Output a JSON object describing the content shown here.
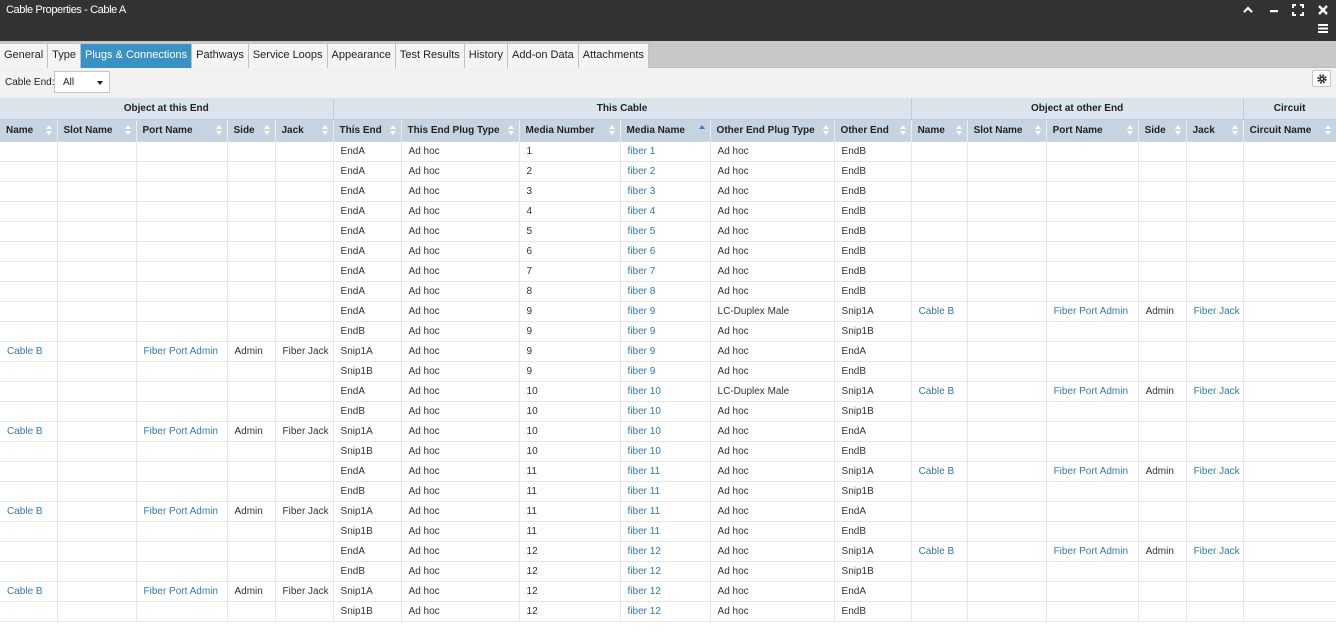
{
  "window": {
    "title": "Cable Properties - Cable A",
    "controls": [
      "chevron-up-icon",
      "minimize-icon",
      "maximize-icon",
      "close-icon",
      "menu-icon"
    ]
  },
  "tabs": [
    "General",
    "Type",
    "Plugs & Connections",
    "Pathways",
    "Service Loops",
    "Appearance",
    "Test Results",
    "History",
    "Add-on Data",
    "Attachments"
  ],
  "active_tab": "Plugs & Connections",
  "toolbar": {
    "cable_end_label": "Cable End:",
    "cable_end_value": "All",
    "settings_icon": "gear-icon"
  },
  "colors": {
    "titlebar": "#333333",
    "active_tab": "#3a92c4",
    "link": "#3478ad",
    "header": "#c6d4e2"
  },
  "grid": {
    "groups": [
      {
        "label": "Object at this End",
        "span": 5
      },
      {
        "label": "This Cable",
        "span": 6
      },
      {
        "label": "Object at other End",
        "span": 5
      },
      {
        "label": "Circuit",
        "span": 1
      }
    ],
    "columns": [
      "Name",
      "Slot Name",
      "Port Name",
      "Side",
      "Jack",
      "This End",
      "This End Plug Type",
      "Media Number",
      "Media Name",
      "Other End Plug Type",
      "Other End",
      "Name",
      "Slot Name",
      "Port Name",
      "Side",
      "Jack",
      "Circuit Name"
    ],
    "sorted_column": "Media Name",
    "rows": [
      [
        "",
        "",
        "",
        "",
        "",
        "EndA",
        "Ad hoc",
        "1",
        "fiber 1",
        "Ad hoc",
        "EndB",
        "",
        "",
        "",
        "",
        "",
        ""
      ],
      [
        "",
        "",
        "",
        "",
        "",
        "EndA",
        "Ad hoc",
        "2",
        "fiber 2",
        "Ad hoc",
        "EndB",
        "",
        "",
        "",
        "",
        "",
        ""
      ],
      [
        "",
        "",
        "",
        "",
        "",
        "EndA",
        "Ad hoc",
        "3",
        "fiber 3",
        "Ad hoc",
        "EndB",
        "",
        "",
        "",
        "",
        "",
        ""
      ],
      [
        "",
        "",
        "",
        "",
        "",
        "EndA",
        "Ad hoc",
        "4",
        "fiber 4",
        "Ad hoc",
        "EndB",
        "",
        "",
        "",
        "",
        "",
        ""
      ],
      [
        "",
        "",
        "",
        "",
        "",
        "EndA",
        "Ad hoc",
        "5",
        "fiber 5",
        "Ad hoc",
        "EndB",
        "",
        "",
        "",
        "",
        "",
        ""
      ],
      [
        "",
        "",
        "",
        "",
        "",
        "EndA",
        "Ad hoc",
        "6",
        "fiber 6",
        "Ad hoc",
        "EndB",
        "",
        "",
        "",
        "",
        "",
        ""
      ],
      [
        "",
        "",
        "",
        "",
        "",
        "EndA",
        "Ad hoc",
        "7",
        "fiber 7",
        "Ad hoc",
        "EndB",
        "",
        "",
        "",
        "",
        "",
        ""
      ],
      [
        "",
        "",
        "",
        "",
        "",
        "EndA",
        "Ad hoc",
        "8",
        "fiber 8",
        "Ad hoc",
        "EndB",
        "",
        "",
        "",
        "",
        "",
        ""
      ],
      [
        "",
        "",
        "",
        "",
        "",
        "EndA",
        "Ad hoc",
        "9",
        "fiber 9",
        "LC-Duplex Male",
        "Snip1A",
        "Cable B",
        "",
        "Fiber Port Admin",
        "Admin",
        "Fiber Jack",
        ""
      ],
      [
        "",
        "",
        "",
        "",
        "",
        "EndB",
        "Ad hoc",
        "9",
        "fiber 9",
        "Ad hoc",
        "Snip1B",
        "",
        "",
        "",
        "",
        "",
        ""
      ],
      [
        "Cable B",
        "",
        "Fiber Port Admin",
        "Admin",
        "Fiber Jack",
        "Snip1A",
        "Ad hoc",
        "9",
        "fiber 9",
        "Ad hoc",
        "EndA",
        "",
        "",
        "",
        "",
        "",
        ""
      ],
      [
        "",
        "",
        "",
        "",
        "",
        "Snip1B",
        "Ad hoc",
        "9",
        "fiber 9",
        "Ad hoc",
        "EndB",
        "",
        "",
        "",
        "",
        "",
        ""
      ],
      [
        "",
        "",
        "",
        "",
        "",
        "EndA",
        "Ad hoc",
        "10",
        "fiber 10",
        "LC-Duplex Male",
        "Snip1A",
        "Cable B",
        "",
        "Fiber Port Admin",
        "Admin",
        "Fiber Jack",
        ""
      ],
      [
        "",
        "",
        "",
        "",
        "",
        "EndB",
        "Ad hoc",
        "10",
        "fiber 10",
        "Ad hoc",
        "Snip1B",
        "",
        "",
        "",
        "",
        "",
        ""
      ],
      [
        "Cable B",
        "",
        "Fiber Port Admin",
        "Admin",
        "Fiber Jack",
        "Snip1A",
        "Ad hoc",
        "10",
        "fiber 10",
        "Ad hoc",
        "EndA",
        "",
        "",
        "",
        "",
        "",
        ""
      ],
      [
        "",
        "",
        "",
        "",
        "",
        "Snip1B",
        "Ad hoc",
        "10",
        "fiber 10",
        "Ad hoc",
        "EndB",
        "",
        "",
        "",
        "",
        "",
        ""
      ],
      [
        "",
        "",
        "",
        "",
        "",
        "EndA",
        "Ad hoc",
        "11",
        "fiber 11",
        "Ad hoc",
        "Snip1A",
        "Cable B",
        "",
        "Fiber Port Admin",
        "Admin",
        "Fiber Jack",
        ""
      ],
      [
        "",
        "",
        "",
        "",
        "",
        "EndB",
        "Ad hoc",
        "11",
        "fiber 11",
        "Ad hoc",
        "Snip1B",
        "",
        "",
        "",
        "",
        "",
        ""
      ],
      [
        "Cable B",
        "",
        "Fiber Port Admin",
        "Admin",
        "Fiber Jack",
        "Snip1A",
        "Ad hoc",
        "11",
        "fiber 11",
        "Ad hoc",
        "EndA",
        "",
        "",
        "",
        "",
        "",
        ""
      ],
      [
        "",
        "",
        "",
        "",
        "",
        "Snip1B",
        "Ad hoc",
        "11",
        "fiber 11",
        "Ad hoc",
        "EndB",
        "",
        "",
        "",
        "",
        "",
        ""
      ],
      [
        "",
        "",
        "",
        "",
        "",
        "EndA",
        "Ad hoc",
        "12",
        "fiber 12",
        "Ad hoc",
        "Snip1A",
        "Cable B",
        "",
        "Fiber Port Admin",
        "Admin",
        "Fiber Jack",
        ""
      ],
      [
        "",
        "",
        "",
        "",
        "",
        "EndB",
        "Ad hoc",
        "12",
        "fiber 12",
        "Ad hoc",
        "Snip1B",
        "",
        "",
        "",
        "",
        "",
        ""
      ],
      [
        "Cable B",
        "",
        "Fiber Port Admin",
        "Admin",
        "Fiber Jack",
        "Snip1A",
        "Ad hoc",
        "12",
        "fiber 12",
        "Ad hoc",
        "EndA",
        "",
        "",
        "",
        "",
        "",
        ""
      ],
      [
        "",
        "",
        "",
        "",
        "",
        "Snip1B",
        "Ad hoc",
        "12",
        "fiber 12",
        "Ad hoc",
        "EndB",
        "",
        "",
        "",
        "",
        "",
        ""
      ]
    ]
  }
}
